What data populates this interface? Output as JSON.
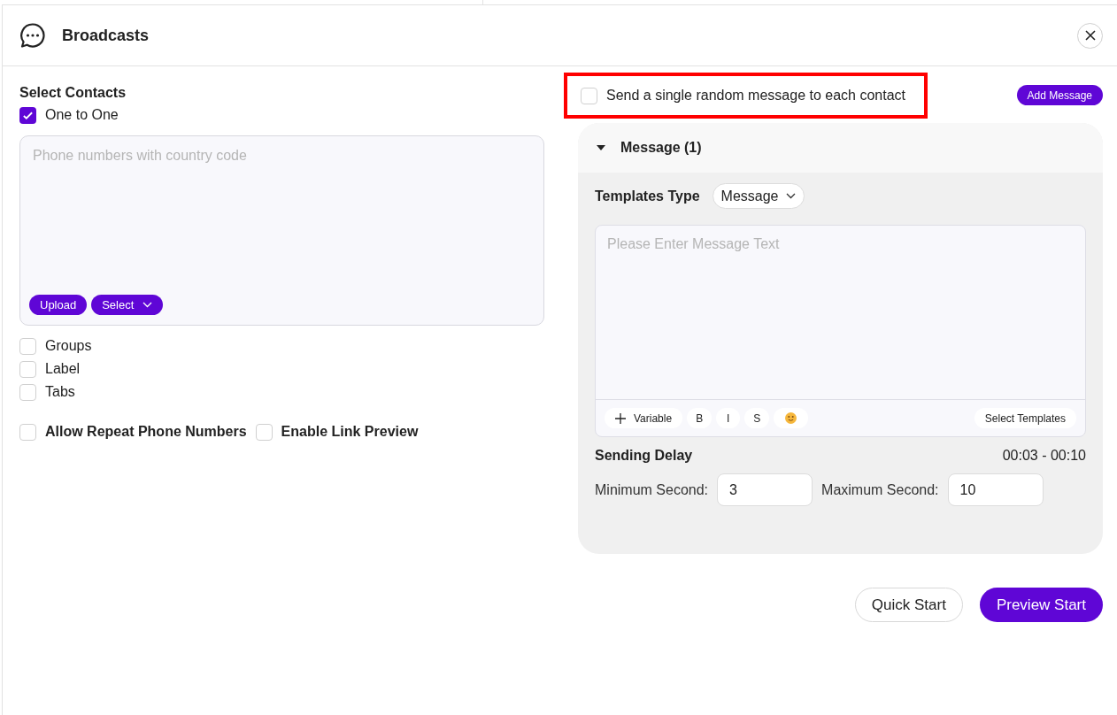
{
  "window": {
    "title": "Broadcasts"
  },
  "contacts": {
    "heading": "Select Contacts",
    "sources": [
      {
        "label": "One to One",
        "checked": true
      },
      {
        "label": "Groups",
        "checked": false
      },
      {
        "label": "Label",
        "checked": false
      },
      {
        "label": "Tabs",
        "checked": false
      }
    ],
    "phone_field": {
      "placeholder": "Phone numbers with country code"
    },
    "buttons": [
      {
        "label": "Upload",
        "kind": "plain"
      },
      {
        "label": "Select",
        "kind": "dropdown"
      }
    ]
  },
  "options": [
    {
      "label": "Allow Repeat Phone Numbers",
      "checked": false
    },
    {
      "label": "Enable Link Preview",
      "checked": false
    }
  ],
  "random_message": {
    "label": "Send a single random message to each contact",
    "checked": false,
    "highlighted": true
  },
  "add_message_button": "Add Message",
  "message_panel": {
    "title": "Message (1)",
    "expanded": true,
    "templates_type": {
      "label": "Templates Type",
      "value": "Message"
    },
    "message_field": {
      "placeholder": "Please Enter Message Text"
    },
    "toolbar": [
      {
        "kind": "variable",
        "label": "Variable"
      },
      {
        "kind": "format",
        "label": "B"
      },
      {
        "kind": "format",
        "label": "I"
      },
      {
        "kind": "format",
        "label": "S"
      },
      {
        "kind": "emoji"
      }
    ],
    "select_templates": "Select Templates",
    "sending_delay": {
      "label": "Sending Delay",
      "range": "00:03 - 00:10",
      "fields": [
        {
          "label": "Minimum Second:",
          "value": "3"
        },
        {
          "label": "Maximum Second:",
          "value": "10"
        }
      ]
    }
  },
  "footer_buttons": [
    {
      "label": "Quick Start",
      "kind": "secondary"
    },
    {
      "label": "Preview Start",
      "kind": "primary"
    }
  ]
}
